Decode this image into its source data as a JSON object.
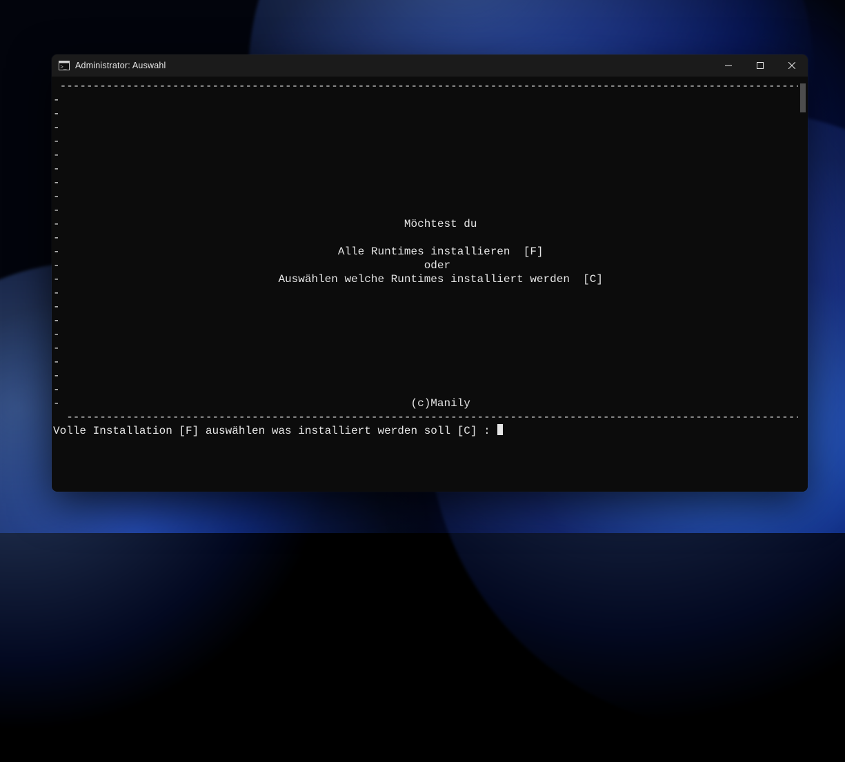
{
  "window": {
    "title": "Administrator:  Auswahl"
  },
  "box": {
    "line1": "Möchtest du",
    "line2": "Alle Runtimes installieren  [F]",
    "line3": "oder",
    "line4": "Auswählen welche Runtimes installiert werden  [C]",
    "footer": "(c)Manily"
  },
  "prompt": {
    "text": "Volle Installation [F] auswählen was installiert werden soll [C] :"
  }
}
